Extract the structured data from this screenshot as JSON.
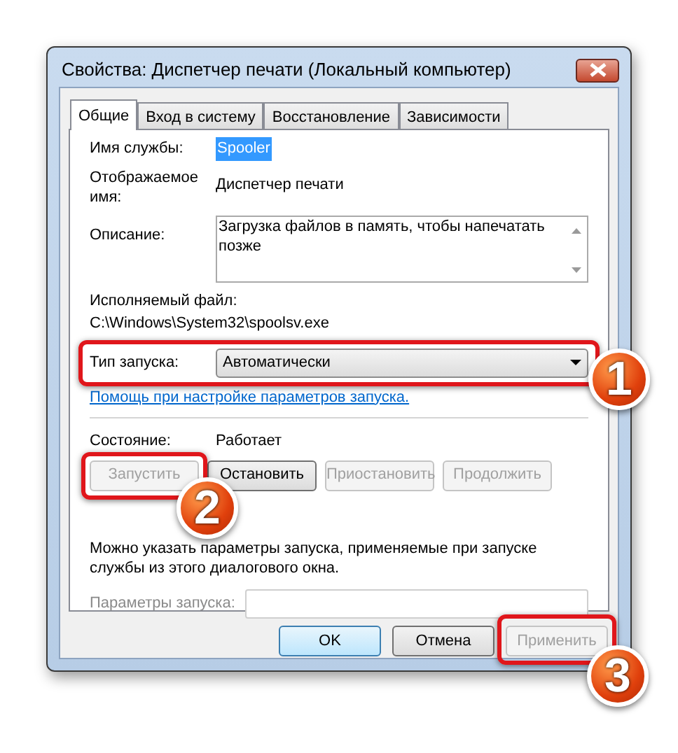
{
  "window": {
    "title": "Свойства: Диспетчер печати (Локальный компьютер)"
  },
  "tabs": [
    {
      "label": "Общие",
      "selected": true
    },
    {
      "label": "Вход в систему",
      "selected": false
    },
    {
      "label": "Восстановление",
      "selected": false
    },
    {
      "label": "Зависимости",
      "selected": false
    }
  ],
  "service_name": {
    "label": "Имя службы:",
    "value": "Spooler"
  },
  "display_name": {
    "label": "Отображаемое имя:",
    "value": "Диспетчер печати"
  },
  "description": {
    "label": "Описание:",
    "value": "Загрузка файлов в память, чтобы напечатать позже"
  },
  "executable": {
    "label": "Исполняемый файл:",
    "value": "C:\\Windows\\System32\\spoolsv.exe"
  },
  "startup_type": {
    "label": "Тип запуска:",
    "value": "Автоматически"
  },
  "help_link": "Помощь при настройке параметров запуска.",
  "status": {
    "label": "Состояние:",
    "value": "Работает"
  },
  "service_buttons": [
    {
      "label": "Запустить",
      "disabled": true
    },
    {
      "label": "Остановить",
      "disabled": false
    },
    {
      "label": "Приостановить",
      "disabled": true
    },
    {
      "label": "Продолжить",
      "disabled": true
    }
  ],
  "hint": "Можно указать параметры запуска, применяемые при запуске службы из этого диалогового окна.",
  "start_params": {
    "label": "Параметры запуска:",
    "disabled": true
  },
  "dialog_buttons": [
    {
      "label": "OK",
      "default": true,
      "disabled": false
    },
    {
      "label": "Отмена",
      "default": false,
      "disabled": false
    },
    {
      "label": "Применить",
      "default": false,
      "disabled": true
    }
  ],
  "callouts": [
    "1",
    "2",
    "3"
  ]
}
